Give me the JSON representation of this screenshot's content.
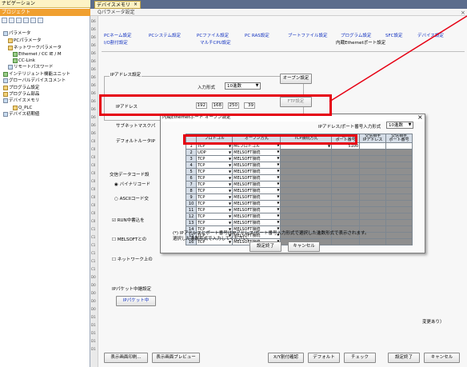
{
  "nav": {
    "title": "ナビゲーション",
    "pin": "ᵖ ×",
    "project": "プロジェクト",
    "tree": [
      "パラメータ",
      "PCパラメータ",
      "ネットワークパラメータ",
      "Ethernet / CC IE / M",
      "CC-Link",
      "リモートパスワード",
      "インテリジェント機能ユニット",
      "グローバルデバイスコメント",
      "プログラム設定",
      "プログラム部品",
      "デバイスメモリ",
      "Q_PLC",
      "デバイス初期値"
    ]
  },
  "tabs": {
    "main": "デバイスメモリQ_PLC",
    "close": "×",
    "subtitle": "Qパラメータ設定"
  },
  "gutter": [
    "D6",
    "D6",
    "D6",
    "D6",
    "D6",
    "D6",
    "D6",
    "D6",
    "D6",
    "D6",
    "D6",
    "D6",
    "D6",
    "D6",
    "D6",
    "C0",
    "C0",
    "C0",
    "C0",
    "C0",
    "C0",
    "C0",
    "C0",
    "C0",
    "C0",
    "C0",
    "C1",
    "C1",
    "C1",
    "C1",
    "C1",
    "C1",
    "D0",
    "D0",
    "D0",
    "D0",
    "D0",
    "D1",
    "D1",
    "D1",
    "D1",
    "D1"
  ],
  "topnav": {
    "row1": [
      "PCネーム設定",
      "PCシステム設定",
      "PCファイル設定",
      "PC RAS設定",
      "ブートファイル設定",
      "プログラム設定",
      "SFC設定",
      "デバイス設定"
    ],
    "row2": [
      "I/O割付設定",
      "マルチCPU設定",
      "内蔵Ethernetポート設定"
    ]
  },
  "ip": {
    "section": "IPアドレス設定",
    "input_format_label": "入力形式",
    "input_format_value": "10進数",
    "open_button": "オープン設定",
    "address_label": "IPアドレス",
    "octets": [
      "192",
      "168",
      "250",
      "39"
    ],
    "frag_button": "FTP設定",
    "subnet_label": "サブネットマスクパ",
    "gateway_label": "デフォルトルータIP"
  },
  "side": {
    "comm_label": "交信データコード設",
    "binary": "バイナリコード",
    "ascii": "ASCIIコード交",
    "run_write": "RUN中書込を",
    "melsoft": "MELSOFTとの",
    "network": "ネットワーク上の",
    "ippacket": "IPパケット中継設定",
    "ippacket_btn": "IPパケット中",
    "tail": "変更あり）"
  },
  "dialog": {
    "title": "内蔵Ethernetポート オープン設定",
    "input_format_label": "IPアドレス/ポート番号入力形式",
    "input_format_value": "10進数",
    "headers": [
      "プロトコル",
      "オープン方式",
      "TCP接続方式",
      "自局\nポート番号",
      "交信相手\nIPアドレス",
      "交信相手\nポート番号"
    ],
    "rows": [
      {
        "no": "1",
        "proto": "TCP",
        "open": "MCプロトコル",
        "port": "5100"
      },
      {
        "no": "2",
        "proto": "UDP",
        "open": "MELSOFT接続",
        "port": ""
      },
      {
        "no": "3",
        "proto": "TCP",
        "open": "MELSOFT接続",
        "port": ""
      },
      {
        "no": "4",
        "proto": "TCP",
        "open": "MELSOFT接続",
        "port": ""
      },
      {
        "no": "5",
        "proto": "TCP",
        "open": "MELSOFT接続",
        "port": ""
      },
      {
        "no": "6",
        "proto": "TCP",
        "open": "MELSOFT接続",
        "port": ""
      },
      {
        "no": "7",
        "proto": "TCP",
        "open": "MELSOFT接続",
        "port": ""
      },
      {
        "no": "8",
        "proto": "TCP",
        "open": "MELSOFT接続",
        "port": ""
      },
      {
        "no": "9",
        "proto": "TCP",
        "open": "MELSOFT接続",
        "port": ""
      },
      {
        "no": "10",
        "proto": "TCP",
        "open": "MELSOFT接続",
        "port": ""
      },
      {
        "no": "11",
        "proto": "TCP",
        "open": "MELSOFT接続",
        "port": ""
      },
      {
        "no": "12",
        "proto": "TCP",
        "open": "MELSOFT接続",
        "port": ""
      },
      {
        "no": "13",
        "proto": "TCP",
        "open": "MELSOFT接続",
        "port": ""
      },
      {
        "no": "14",
        "proto": "TCP",
        "open": "MELSOFT接続",
        "port": ""
      },
      {
        "no": "15",
        "proto": "TCP",
        "open": "MELSOFT接続",
        "port": ""
      },
      {
        "no": "16",
        "proto": "TCP",
        "open": "MELSOFT接続",
        "port": ""
      }
    ],
    "note1": "(*) IPアドレスとポート番号はIPアドレス/ポート番号入力形式で選択した進数形式で表示されます。",
    "note2": "  選択した進数形式で入力してください。",
    "ok": "設定終了",
    "cancel": "キャンセル"
  },
  "bottom": {
    "print": "表示画面印刷...",
    "preview": "表示画面プレビュー",
    "xy": "X/Y割付確認",
    "default": "デフォルト",
    "check": "チェック",
    "finish": "設定終了",
    "cancel": "キャンセル"
  },
  "colors": {
    "highlight": "#e60012",
    "link": "#1030c0"
  }
}
